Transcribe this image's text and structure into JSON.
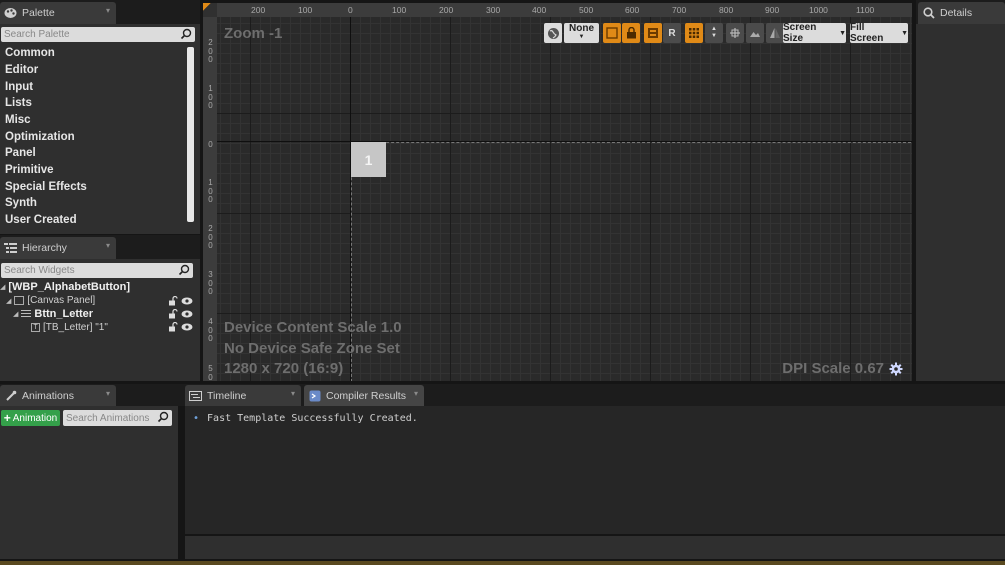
{
  "palette": {
    "tab_label": "Palette",
    "search_placeholder": "Search Palette",
    "categories": [
      "Common",
      "Editor",
      "Input",
      "Lists",
      "Misc",
      "Optimization",
      "Panel",
      "Primitive",
      "Special Effects",
      "Synth",
      "User Created"
    ]
  },
  "hierarchy": {
    "tab_label": "Hierarchy",
    "search_placeholder": "Search Widgets",
    "root": "[WBP_AlphabetButton]",
    "canvas_panel": "[Canvas Panel]",
    "button": "Bttn_Letter",
    "text_block": "[TB_Letter] \"1\""
  },
  "designer": {
    "zoom": "Zoom -1",
    "device_scale": "Device Content Scale 1.0",
    "safe_zone": "No Device Safe Zone Set",
    "resolution": "1280 x 720 (16:9)",
    "dpi": "DPI Scale 0.67",
    "widget_label": "1",
    "ruler_top": [
      "200",
      "100",
      "0",
      "100",
      "200",
      "300",
      "400",
      "500",
      "600",
      "700",
      "800",
      "900",
      "1000",
      "1100"
    ],
    "ruler_left": [
      "2\n0\n0",
      "1\n0\n0",
      "0",
      "1\n0\n0",
      "2\n0\n0",
      "3\n0\n0",
      "4\n0\n0",
      "5\n0"
    ],
    "toolbar": {
      "none_label": "None",
      "r_label": "R",
      "screen_size_label": "Screen Size",
      "fill_screen_label": "Fill Screen"
    }
  },
  "details": {
    "tab_label": "Details"
  },
  "animations": {
    "tab_label": "Animations",
    "add_label": "Animation",
    "search_placeholder": "Search Animations"
  },
  "timeline": {
    "tab_label": "Timeline"
  },
  "compiler": {
    "tab_label": "Compiler Results",
    "message": "Fast Template Successfully Created."
  },
  "colors": {
    "accent_orange": "#e08a17",
    "add_green": "#34a04a"
  }
}
